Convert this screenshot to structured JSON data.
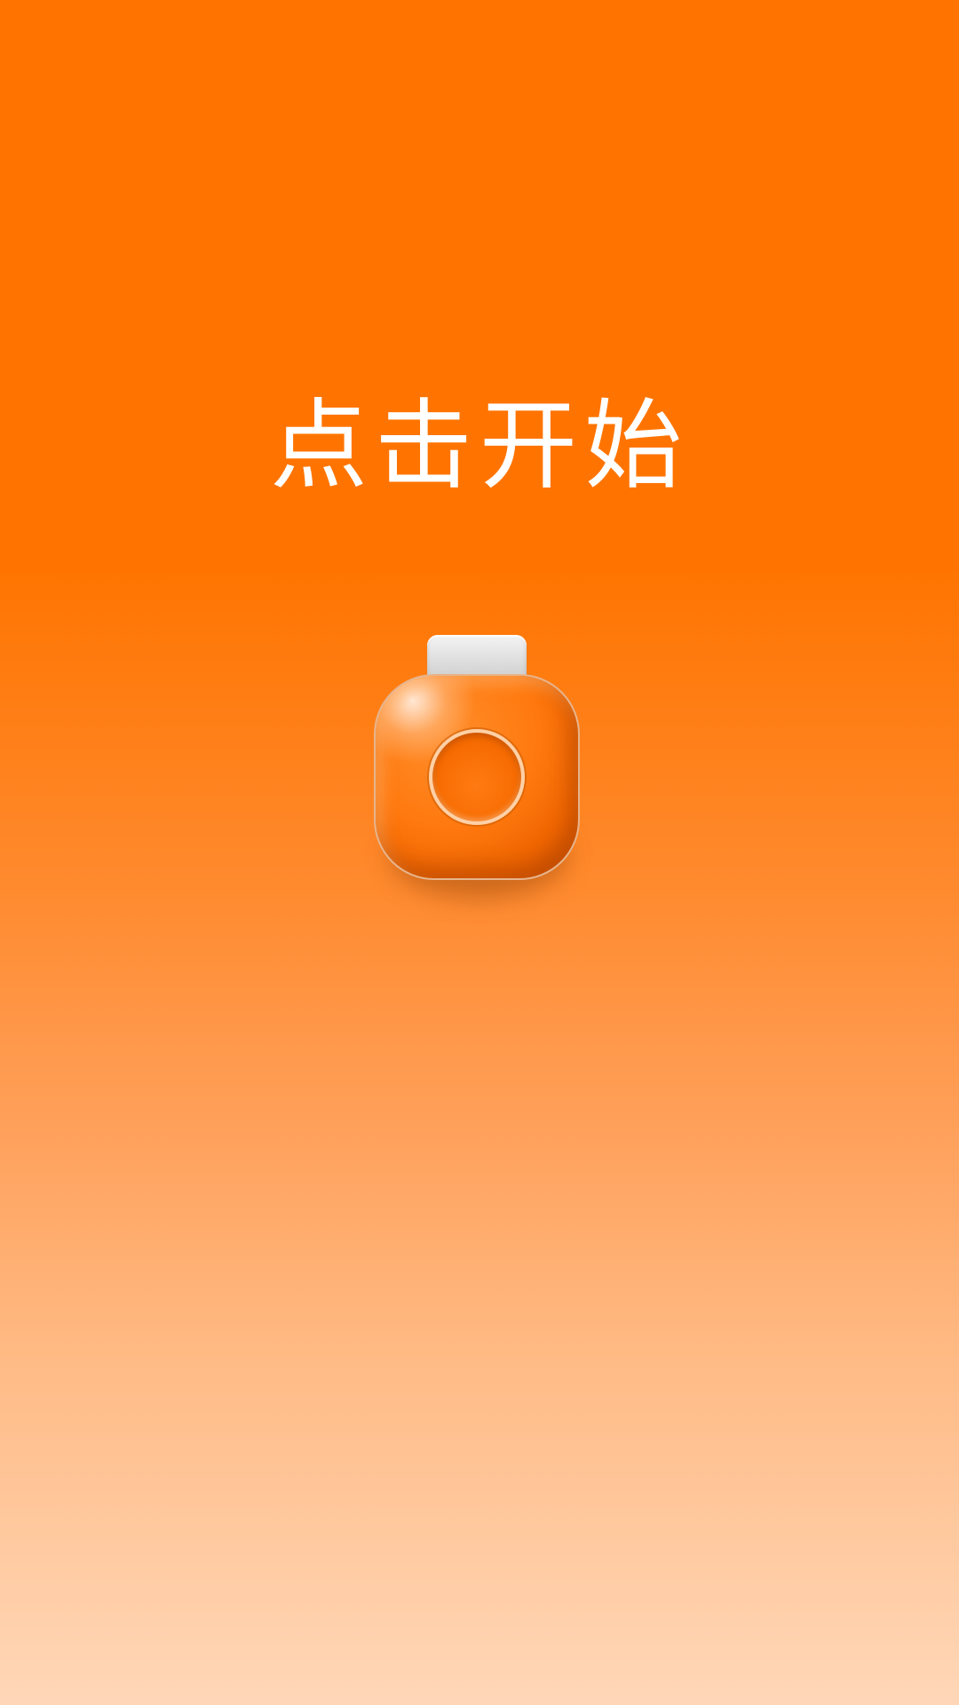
{
  "screen": {
    "title": "点击开始"
  },
  "colors": {
    "background_top": "#ff7300",
    "background_bottom": "#ffd7b8",
    "title_text": "#ffffff",
    "device_orange": "#ff7a10",
    "device_clip": "#d9d9d9"
  },
  "icons": {
    "start_button": "tally-counter-icon"
  }
}
